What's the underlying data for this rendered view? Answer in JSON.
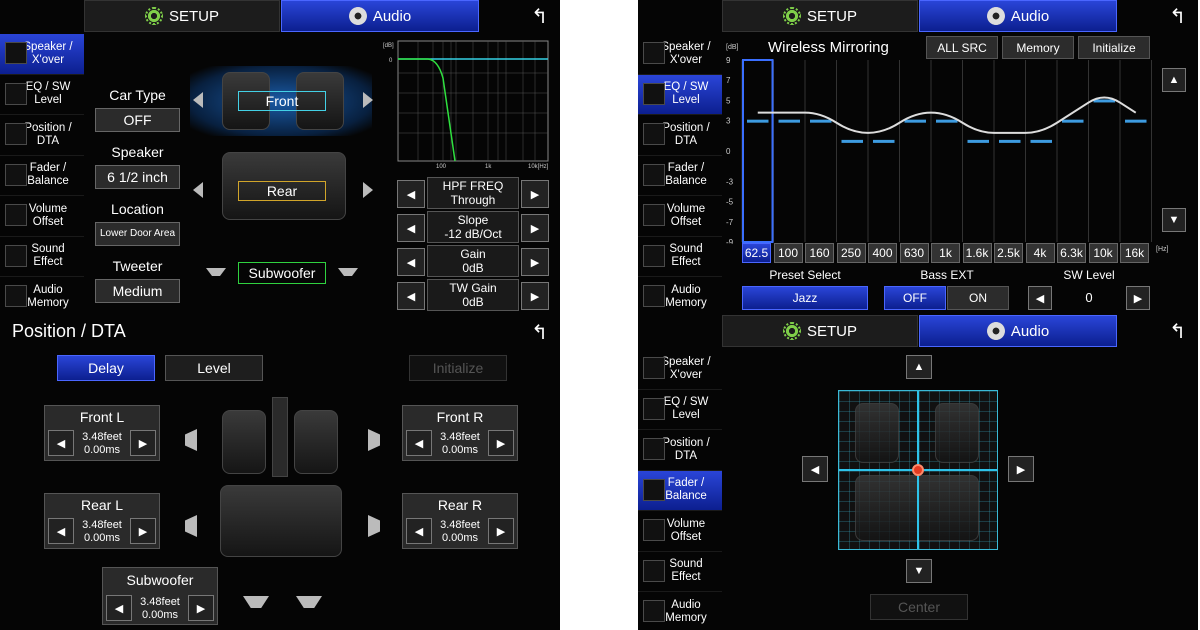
{
  "tabs": {
    "setup": "SETUP",
    "audio": "Audio"
  },
  "sidebar": [
    "Speaker /\nX'over",
    "EQ / SW\nLevel",
    "Position /\nDTA",
    "Fader /\nBalance",
    "Volume\nOffset",
    "Sound\nEffect",
    "Audio\nMemory"
  ],
  "speaker": {
    "car_type_label": "Car Type",
    "car_type_value": "OFF",
    "speaker_label": "Speaker",
    "speaker_value": "6 1/2 inch",
    "location_label": "Location",
    "location_value": "Lower Door Area",
    "tweeter_label": "Tweeter",
    "tweeter_value": "Medium",
    "front": "Front",
    "rear": "Rear",
    "subwoofer": "Subwoofer",
    "graph": {
      "db_label": "[dB]",
      "zero": "0",
      "x_ticks": [
        "100",
        "1k",
        "10k[Hz]"
      ]
    },
    "params": [
      {
        "label": "HPF FREQ",
        "value": "Through"
      },
      {
        "label": "Slope",
        "value": "-12 dB/Oct"
      },
      {
        "label": "Gain",
        "value": "0dB"
      },
      {
        "label": "TW Gain",
        "value": "0dB"
      }
    ]
  },
  "eq": {
    "title": "Wireless Mirroring",
    "all_src": "ALL SRC",
    "memory": "Memory",
    "initialize": "Initialize",
    "db_unit": "[dB]",
    "y_ticks": [
      "9",
      "7",
      "5",
      "3",
      "0",
      "-3",
      "-5",
      "-7",
      "-9"
    ],
    "bands": [
      "62.5",
      "100",
      "160",
      "250",
      "400",
      "630",
      "1k",
      "1.6k",
      "2.5k",
      "4k",
      "6.3k",
      "10k",
      "16k"
    ],
    "band_levels": [
      3,
      3,
      3,
      1,
      1,
      3,
      3,
      1,
      1,
      1,
      3,
      5,
      3
    ],
    "hz_unit": "[Hz]",
    "preset_label": "Preset Select",
    "preset_value": "Jazz",
    "bass_label": "Bass EXT",
    "bass_off": "OFF",
    "bass_on": "ON",
    "sw_label": "SW Level",
    "sw_value": "0"
  },
  "position": {
    "title": "Position / DTA",
    "delay": "Delay",
    "level": "Level",
    "initialize": "Initialize",
    "front_l": {
      "name": "Front L",
      "dist": "3.48feet",
      "time": "0.00ms"
    },
    "front_r": {
      "name": "Front R",
      "dist": "3.48feet",
      "time": "0.00ms"
    },
    "rear_l": {
      "name": "Rear L",
      "dist": "3.48feet",
      "time": "0.00ms"
    },
    "rear_r": {
      "name": "Rear R",
      "dist": "3.48feet",
      "time": "0.00ms"
    },
    "sub": {
      "name": "Subwoofer",
      "dist": "3.48feet",
      "time": "0.00ms"
    }
  },
  "fader": {
    "center": "Center"
  }
}
